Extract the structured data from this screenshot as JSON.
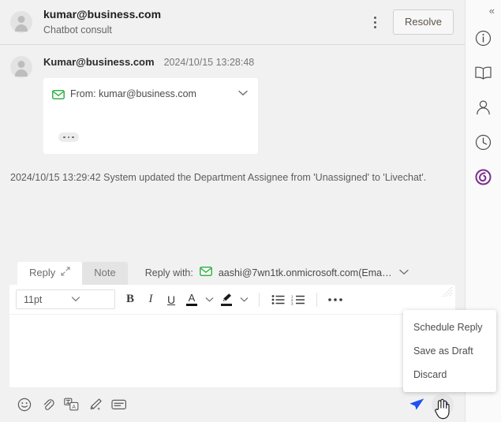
{
  "header": {
    "title": "kumar@business.com",
    "subtitle": "Chatbot consult",
    "more_icon": "kebab-menu-icon",
    "resolve_label": "Resolve"
  },
  "message": {
    "sender": "Kumar@business.com",
    "timestamp": "2024/10/15 13:28:48",
    "card": {
      "from_text": "From: kumar@business.com",
      "envelope_icon": "envelope-icon",
      "envelope_color": "#35b04a",
      "expand_icon": "chevron-down-icon",
      "collapsed_content_icon": "ellipsis-pill-icon"
    }
  },
  "system_event": {
    "text": "2024/10/15 13:29:42 System updated the Department Assignee from 'Unassigned' to 'Livechat'."
  },
  "composer": {
    "tabs": [
      {
        "label": "Reply",
        "active": true,
        "expand_icon": "expand-diagonal-icon"
      },
      {
        "label": "Note",
        "active": false
      }
    ],
    "reply_with_label": "Reply with:",
    "reply_with_value": "aashi@7wn1tk.onmicrosoft.com(Ema…",
    "reply_with_icon": "envelope-icon",
    "reply_with_caret": "chevron-down-icon",
    "resize_handle_icon": "resize-grip-icon",
    "toolbar": {
      "font_size": "11pt",
      "font_size_caret": "chevron-down-icon",
      "bold": "B",
      "italic": "I",
      "underline": "U",
      "font_color": "A",
      "font_color_caret": "chevron-down-icon",
      "highlight_icon": "highlighter-pen-icon",
      "highlight_caret": "chevron-down-icon",
      "bullet_list_icon": "bullet-list-icon",
      "numbered_list_icon": "numbered-list-icon",
      "more_icon": "ellipsis-horizontal-icon"
    },
    "editor_value": "",
    "bottom_icons": [
      "emoji-icon",
      "attachment-paperclip-icon",
      "translate-icon",
      "ai-magic-pen-icon",
      "canned-response-icon"
    ],
    "send_icon": "send-paper-plane-icon",
    "send_icon_color": "#1a4df5",
    "send_options_icon": "chevron-down-icon"
  },
  "send_menu": {
    "items": [
      "Schedule Reply",
      "Save as Draft",
      "Discard"
    ]
  },
  "rail": {
    "collapse_icon": "collapse-left-chevrons-icon",
    "collapse_glyph": "«",
    "items": [
      {
        "icon": "info-circle-icon",
        "name": "info"
      },
      {
        "icon": "book-icon",
        "name": "knowledge-base"
      },
      {
        "icon": "person-icon",
        "name": "contact"
      },
      {
        "icon": "clock-history-icon",
        "name": "history"
      },
      {
        "icon": "purple-swirl-logo-icon",
        "name": "assistant",
        "color": "#7b2e8e"
      }
    ]
  },
  "cursor": {
    "icon": "hand-pointer-cursor"
  }
}
